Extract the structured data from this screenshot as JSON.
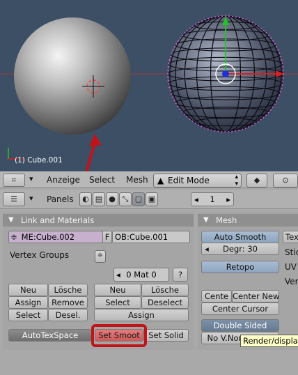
{
  "viewport": {
    "object_label": "(1) Cube.001"
  },
  "header": {
    "menus": [
      "Anzeige",
      "Select",
      "Mesh"
    ],
    "mode_label": "Edit Mode"
  },
  "buttons_header": {
    "panels_label": "Panels",
    "frame_value": "1"
  },
  "link_materials": {
    "title": "Link and Materials",
    "mesh_name": "ME:Cube.002",
    "f_label": "F",
    "object_name": "OB:Cube.001",
    "vertex_groups_label": "Vertex Groups",
    "mat_label": "0 Mat 0",
    "question_label": "?",
    "vg_new": "Neu",
    "vg_delete": "Lösche",
    "vg_assign": "Assign",
    "vg_remove": "Remove",
    "vg_select": "Select",
    "vg_deselect": "Desel.",
    "mat_new": "Neu",
    "mat_delete": "Lösche",
    "mat_select": "Select",
    "mat_deselect": "Deselect",
    "mat_assign": "Assign",
    "autotexspace": "AutoTexSpace",
    "set_smooth": "Set Smoot",
    "set_solid": "Set Solid"
  },
  "mesh_panel": {
    "title": "Mesh",
    "auto_smooth": "Auto Smooth",
    "degr": "Degr: 30",
    "retopo": "Retopo",
    "center": "Cente",
    "center_new": "Center New",
    "center_cursor": "Center Cursor",
    "double_sided": "Double Sided",
    "no_vnormal_flip": "No V.Normal Flip",
    "side_labels": [
      "Tex",
      "Stic",
      "UV",
      "Ver"
    ]
  },
  "tooltip": "Render/display",
  "colors": {
    "viewport_bg": "#3d4f64",
    "highlight_red": "#c0141a",
    "set_smooth_bg": "#d96a6a"
  }
}
